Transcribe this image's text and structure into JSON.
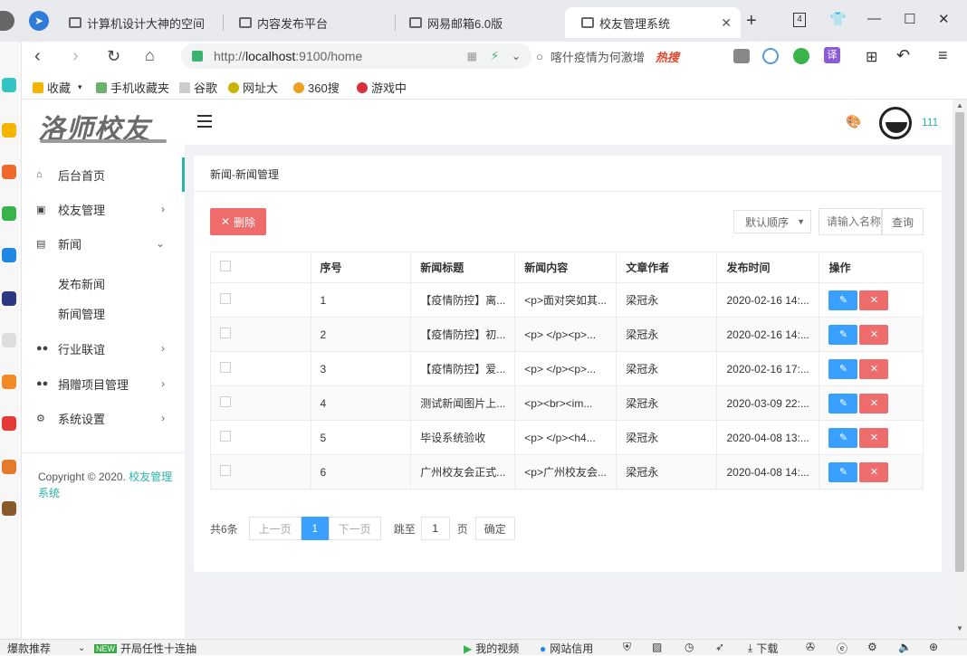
{
  "browser": {
    "tabs": [
      {
        "title": "计算机设计大神的空间"
      },
      {
        "title": "内容发布平台"
      },
      {
        "title": "网易邮箱6.0版"
      },
      {
        "title": "校友管理系统"
      }
    ],
    "tab_count": "4",
    "url_scheme": "http://",
    "url_host": "localhost",
    "url_rest": ":9100/home",
    "search_hint": "喀什疫情为何激增",
    "search_hot": "热搜",
    "bookmarks": [
      "收藏",
      "手机收藏夹",
      "谷歌",
      "网址大",
      "360搜",
      "游戏中"
    ],
    "translate_label": "译"
  },
  "app": {
    "logo": "洛师校友",
    "user_name": "111",
    "menu": [
      {
        "label": "后台首页",
        "icon": "home-icon",
        "glyph": "⌂",
        "arrow": ""
      },
      {
        "label": "校友管理",
        "icon": "id-card-icon",
        "glyph": "▣",
        "arrow": "›"
      },
      {
        "label": "新闻",
        "icon": "news-icon",
        "glyph": "▤",
        "arrow": "⌄"
      },
      {
        "label": "行业联谊",
        "icon": "group-icon",
        "glyph": "👥",
        "arrow": "›"
      },
      {
        "label": "捐赠项目管理",
        "icon": "group-icon",
        "glyph": "👥",
        "arrow": "›"
      },
      {
        "label": "系统设置",
        "icon": "gear-icon",
        "glyph": "⚙",
        "arrow": "›"
      }
    ],
    "submenu": [
      "发布新闻",
      "新闻管理"
    ],
    "copyright_prefix": "Copyright © 2020. ",
    "copyright_link": "校友管理系统"
  },
  "panel": {
    "breadcrumb": "新闻-新闻管理",
    "delete_label": "删除",
    "sort_value": "默认顺序",
    "name_placeholder": "请输入名称",
    "query_label": "查询",
    "columns": [
      "序号",
      "新闻标题",
      "新闻内容",
      "文章作者",
      "发布时间",
      "操作"
    ],
    "rows": [
      {
        "no": "1",
        "title": "【疫情防控】离...",
        "content": "<p>面对突如其...",
        "author": "梁冠永",
        "time": "2020-02-16 14:..."
      },
      {
        "no": "2",
        "title": "【疫情防控】初...",
        "content": "<p> </p><p>...",
        "author": "梁冠永",
        "time": "2020-02-16 14:..."
      },
      {
        "no": "3",
        "title": "【疫情防控】爱...",
        "content": "<p> </p><p>...",
        "author": "梁冠永",
        "time": "2020-02-16 17:..."
      },
      {
        "no": "4",
        "title": "测试新闻图片上...",
        "content": "<p><br><im...",
        "author": "梁冠永",
        "time": "2020-03-09 22:..."
      },
      {
        "no": "5",
        "title": "毕设系统验收",
        "content": "<p> </p><h4...",
        "author": "梁冠永",
        "time": "2020-04-08 13:..."
      },
      {
        "no": "6",
        "title": "广州校友会正式...",
        "content": "<p>广州校友会...",
        "author": "梁冠永",
        "time": "2020-04-08 14:..."
      }
    ],
    "pager": {
      "total": "共6条",
      "prev": "上一页",
      "current": "1",
      "next": "下一页",
      "goto_label": "跳至",
      "goto_value": "1",
      "page_unit": "页",
      "confirm": "确定"
    }
  },
  "statusbar": {
    "left": "爆款推荐",
    "promo": "开局任性十连抽",
    "video": "我的视频",
    "site_trust": "网站信用",
    "download": "下载"
  },
  "colors": {
    "accent": "#2ab3a6",
    "danger": "#ee6c6c",
    "primary": "#3aa0ff"
  }
}
